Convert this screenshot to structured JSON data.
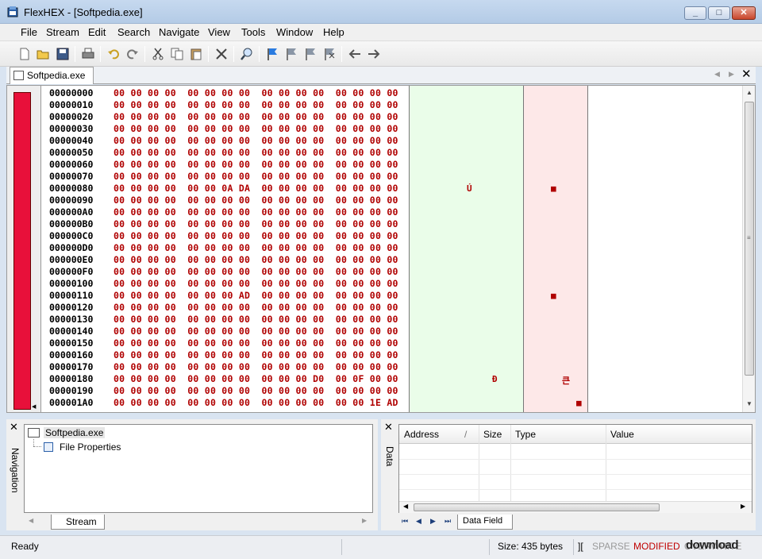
{
  "window": {
    "title": "FlexHEX - [Softpedia.exe]"
  },
  "menu": [
    "File",
    "Stream",
    "Edit",
    "Search",
    "Navigate",
    "View",
    "Tools",
    "Window",
    "Help"
  ],
  "toolbar": {
    "icons": [
      "new-file-icon",
      "open-folder-icon",
      "save-icon",
      "print-icon",
      "undo-icon",
      "redo-icon",
      "cut-icon",
      "copy-icon",
      "paste-icon",
      "delete-icon",
      "find-icon",
      "flag-blue-icon",
      "flag-prev-icon",
      "flag-next-icon",
      "flag-clear-icon",
      "back-arrow-icon",
      "forward-arrow-icon"
    ]
  },
  "document_tab": {
    "label": "Softpedia.exe"
  },
  "hex_view": {
    "rows": [
      {
        "addr": "00000000",
        "hex": "00 00 00 00  00 00 00 00  00 00 00 00  00 00 00 00"
      },
      {
        "addr": "00000010",
        "hex": "00 00 00 00  00 00 00 00  00 00 00 00  00 00 00 00"
      },
      {
        "addr": "00000020",
        "hex": "00 00 00 00  00 00 00 00  00 00 00 00  00 00 00 00"
      },
      {
        "addr": "00000030",
        "hex": "00 00 00 00  00 00 00 00  00 00 00 00  00 00 00 00"
      },
      {
        "addr": "00000040",
        "hex": "00 00 00 00  00 00 00 00  00 00 00 00  00 00 00 00"
      },
      {
        "addr": "00000050",
        "hex": "00 00 00 00  00 00 00 00  00 00 00 00  00 00 00 00"
      },
      {
        "addr": "00000060",
        "hex": "00 00 00 00  00 00 00 00  00 00 00 00  00 00 00 00"
      },
      {
        "addr": "00000070",
        "hex": "00 00 00 00  00 00 00 00  00 00 00 00  00 00 00 00"
      },
      {
        "addr": "00000080",
        "hex": "00 00 00 00  00 00 0A DA  00 00 00 00  00 00 00 00"
      },
      {
        "addr": "00000090",
        "hex": "00 00 00 00  00 00 00 00  00 00 00 00  00 00 00 00"
      },
      {
        "addr": "000000A0",
        "hex": "00 00 00 00  00 00 00 00  00 00 00 00  00 00 00 00"
      },
      {
        "addr": "000000B0",
        "hex": "00 00 00 00  00 00 00 00  00 00 00 00  00 00 00 00"
      },
      {
        "addr": "000000C0",
        "hex": "00 00 00 00  00 00 00 00  00 00 00 00  00 00 00 00"
      },
      {
        "addr": "000000D0",
        "hex": "00 00 00 00  00 00 00 00  00 00 00 00  00 00 00 00"
      },
      {
        "addr": "000000E0",
        "hex": "00 00 00 00  00 00 00 00  00 00 00 00  00 00 00 00"
      },
      {
        "addr": "000000F0",
        "hex": "00 00 00 00  00 00 00 00  00 00 00 00  00 00 00 00"
      },
      {
        "addr": "00000100",
        "hex": "00 00 00 00  00 00 00 00  00 00 00 00  00 00 00 00"
      },
      {
        "addr": "00000110",
        "hex": "00 00 00 00  00 00 00 AD  00 00 00 00  00 00 00 00"
      },
      {
        "addr": "00000120",
        "hex": "00 00 00 00  00 00 00 00  00 00 00 00  00 00 00 00"
      },
      {
        "addr": "00000130",
        "hex": "00 00 00 00  00 00 00 00  00 00 00 00  00 00 00 00"
      },
      {
        "addr": "00000140",
        "hex": "00 00 00 00  00 00 00 00  00 00 00 00  00 00 00 00"
      },
      {
        "addr": "00000150",
        "hex": "00 00 00 00  00 00 00 00  00 00 00 00  00 00 00 00"
      },
      {
        "addr": "00000160",
        "hex": "00 00 00 00  00 00 00 00  00 00 00 00  00 00 00 00"
      },
      {
        "addr": "00000170",
        "hex": "00 00 00 00  00 00 00 00  00 00 00 00  00 00 00 00"
      },
      {
        "addr": "00000180",
        "hex": "00 00 00 00  00 00 00 00  00 00 00 D0  00 0F 00 00"
      },
      {
        "addr": "00000190",
        "hex": "00 00 00 00  00 00 00 00  00 00 00 00  00 00 00 00"
      },
      {
        "addr": "000001A0",
        "hex": "00 00 00 00  00 00 00 00  00 00 00 00  00 00 1E AD"
      }
    ],
    "ascii_marks": [
      {
        "row": 8,
        "char": "Ú"
      },
      {
        "row": 24,
        "char": "Ð"
      }
    ],
    "unicode_marks": [
      {
        "row": 8,
        "char": "■"
      },
      {
        "row": 17,
        "char": "■"
      },
      {
        "row": 24,
        "char": "큰"
      },
      {
        "row": 26,
        "char": "■"
      }
    ]
  },
  "navigation_panel": {
    "label": "Navigation",
    "tree_root": "Softpedia.exe",
    "tree_child": "File Properties",
    "tab": "Stream"
  },
  "data_panel": {
    "label": "Data",
    "columns": [
      "Address",
      "/",
      "Size",
      "Type",
      "Value"
    ],
    "tab": "Data Field"
  },
  "status": {
    "state": "Ready",
    "size": "Size: 435 bytes",
    "cursor_glyph": "][",
    "sparse": "SPARSE",
    "modified": "MODIFIED",
    "overwrite": "OVERWRITE"
  },
  "watermark": "download"
}
